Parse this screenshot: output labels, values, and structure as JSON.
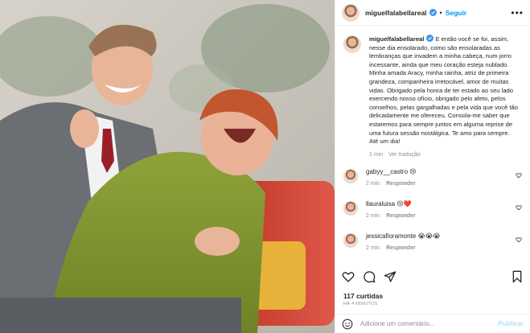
{
  "post": {
    "username": "miguelfalabellareal",
    "follow_label": "Seguir",
    "more_label": "•••",
    "separator": "•",
    "caption_text": "E então você se foi, assim, nesse dia ensolarado, como são ensolaradas as lembranças que invadem a minha cabeça, num jorro incessante, ainda que meu coração esteja nublado. Minha amada Aracy, minha rainha, atriz de primeira grandeza, companheira irretocável, amor de muitas vidas. Obrigado pela honra de ter estado ao seu lado exercendo nosso ofício, obrigado pelo afeto, pelos conselhos, pelas gargalhadas e pela vida que você tão delicadamente me ofereceu. Consola-me saber que estaremos para sempre juntos em alguma reprise de uma futura sessão nostálgica. Te amo para sempre. Até um dia!",
    "caption_time": "1 min",
    "translate_label": "Ver tradução",
    "likes": "117 curtidas",
    "time_ago": "HÁ 4 MINUTOS",
    "accent_color": "#0095f6",
    "verified_color": "#3897f0"
  },
  "comments": [
    {
      "user": "gabyy__castro",
      "emoji": "😢",
      "time": "2 min",
      "reply": "Responder"
    },
    {
      "user": "llauraluisa",
      "emoji": "😢❤️",
      "time": "2 min",
      "reply": "Responder"
    },
    {
      "user": "jessicafioramonte",
      "emoji": "😭😭😭",
      "time": "2 min",
      "reply": "Responder"
    }
  ],
  "actions": {
    "icons": [
      "heart-icon",
      "comment-icon",
      "share-icon",
      "bookmark-icon"
    ]
  },
  "composer": {
    "placeholder": "Adicione um comentário...",
    "publish_label": "Publicar"
  }
}
